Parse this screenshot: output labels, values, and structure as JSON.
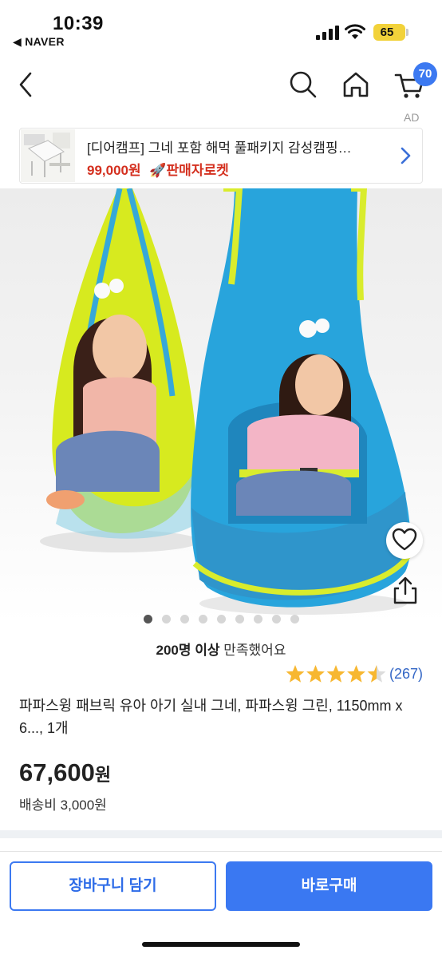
{
  "status_bar": {
    "time": "10:39",
    "back_app": "◀ NAVER",
    "battery": "65"
  },
  "nav": {
    "cart_count": "70"
  },
  "ad": {
    "mark": "AD",
    "title": "[디어캠프] 그네 포함 해먹 풀패키지 감성캠핑…",
    "price": "99,000원",
    "rocket_label": "🚀판매자로켓"
  },
  "gallery": {
    "total_images": 9,
    "active_index": 0
  },
  "satisfaction": {
    "count": "200명 이상",
    "text": " 만족했어요"
  },
  "rating": {
    "stars": 4.5,
    "max": 5,
    "count": "(267)",
    "star_color": "#f7b731"
  },
  "product": {
    "title": "파파스윙 패브릭 유아 아기 실내 그네, 파파스윙 그린, 1150mm x 6..., 1개",
    "price": "67,600",
    "price_unit": "원",
    "shipping": "배송비 3,000원"
  },
  "actions": {
    "add_to_cart": "장바구니 담기",
    "buy_now": "바로구매"
  },
  "colors": {
    "accent": "#3a78f2",
    "ad_price": "#d4301f",
    "rating_link": "#3467c6"
  }
}
